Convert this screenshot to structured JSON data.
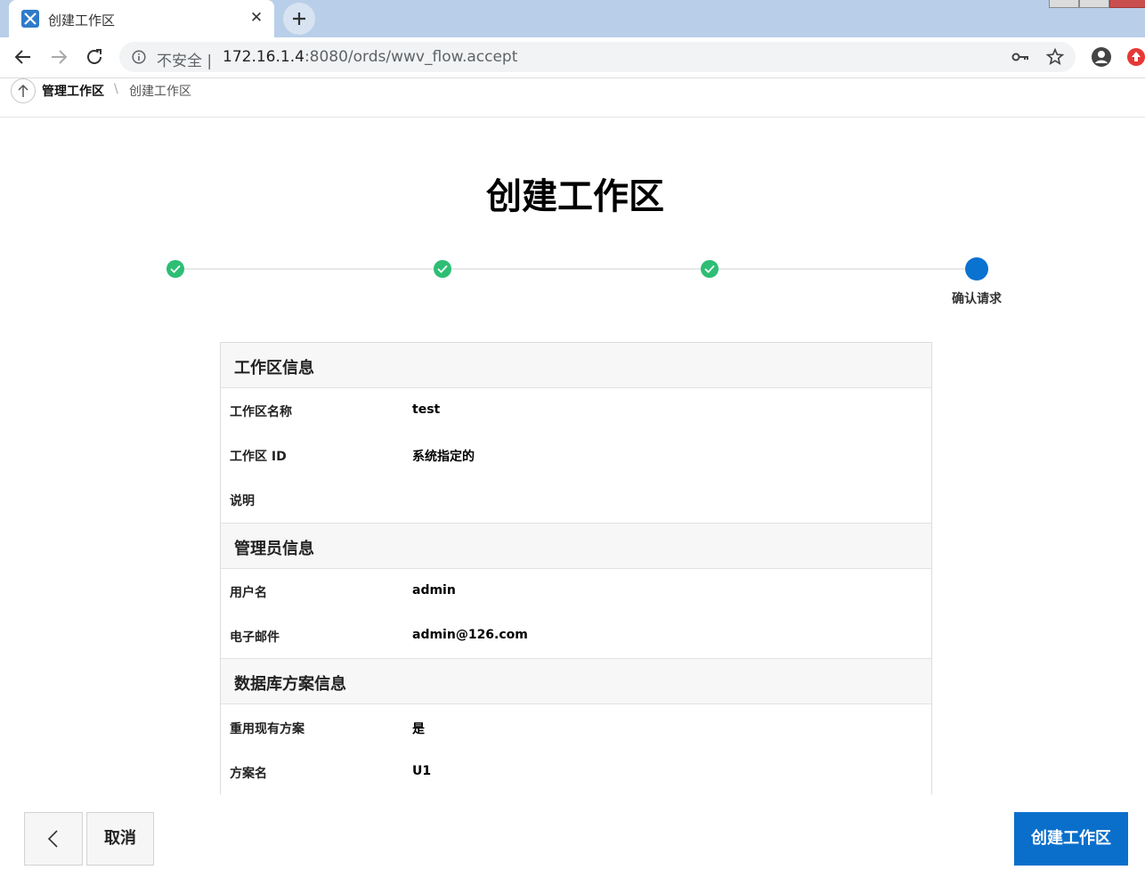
{
  "browser": {
    "tab_title": "创建工作区",
    "insecure_label": "不安全",
    "url_host": "172.16.1.4",
    "url_rest": ":8080/ords/wwv_flow.accept"
  },
  "breadcrumb": {
    "parent": "管理工作区",
    "separator": "\\",
    "current": "创建工作区"
  },
  "page": {
    "title": "创建工作区"
  },
  "wizard": {
    "steps_total": 4,
    "current_step_label": "确认请求"
  },
  "sections": {
    "workspace": {
      "title": "工作区信息",
      "rows": [
        {
          "label": "工作区名称",
          "value": "test"
        },
        {
          "label": "工作区 ID",
          "value": "系统指定的"
        },
        {
          "label": "说明",
          "value": ""
        }
      ]
    },
    "admin": {
      "title": "管理员信息",
      "rows": [
        {
          "label": "用户名",
          "value": "admin"
        },
        {
          "label": "电子邮件",
          "value": "admin@126.com"
        }
      ]
    },
    "schema": {
      "title": "数据库方案信息",
      "rows": [
        {
          "label": "重用现有方案",
          "value": "是"
        },
        {
          "label": "方案名",
          "value": "U1"
        }
      ]
    }
  },
  "footer": {
    "cancel_label": "取消",
    "create_label": "创建工作区"
  },
  "colors": {
    "accent": "#0a72d0",
    "step_done": "#2dbe74"
  }
}
